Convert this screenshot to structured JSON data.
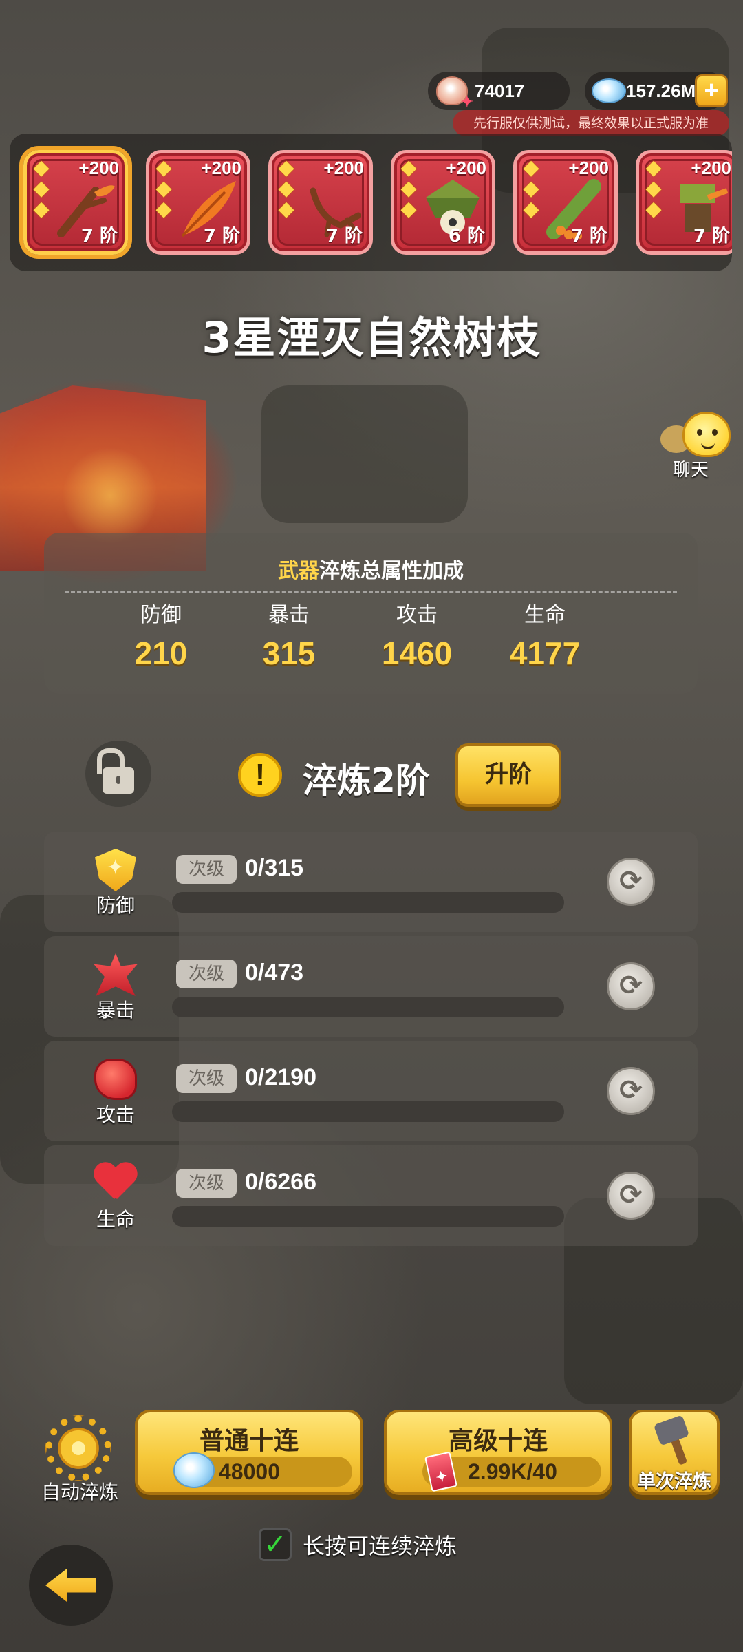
{
  "currency": {
    "shells": "74017",
    "gems": "157.26M",
    "shell_icon": "shell-icon",
    "gem_icon": "gem-icon",
    "notice": "先行服仅供测试，最终效果以正式服为准"
  },
  "weapons": [
    {
      "bonus": "+200",
      "rank": "7 阶",
      "stars": 3,
      "selected": true
    },
    {
      "bonus": "+200",
      "rank": "7 阶",
      "stars": 3
    },
    {
      "bonus": "+200",
      "rank": "7 阶",
      "stars": 3
    },
    {
      "bonus": "+200",
      "rank": "6 阶",
      "stars": 3
    },
    {
      "bonus": "+200",
      "rank": "7 阶",
      "stars": 3
    },
    {
      "bonus": "+200",
      "rank": "7 阶",
      "stars": 3
    }
  ],
  "title": "3星湮灭自然树枝",
  "chat": {
    "label": "聊天"
  },
  "stats": {
    "title_accent": "武器",
    "title_rest": "淬炼总属性加成",
    "items": [
      {
        "name": "防御",
        "value": "210"
      },
      {
        "name": "暴击",
        "value": "315"
      },
      {
        "name": "攻击",
        "value": "1460"
      },
      {
        "name": "生命",
        "value": "4177"
      }
    ]
  },
  "refine": {
    "level": "淬炼2阶",
    "upgrade_label": "升阶"
  },
  "attributes": [
    {
      "label": "防御",
      "grade": "次级",
      "progress": "0/315",
      "fill": 0,
      "icon": "shield-icon"
    },
    {
      "label": "暴击",
      "grade": "次级",
      "progress": "0/473",
      "fill": 0,
      "icon": "crit-icon"
    },
    {
      "label": "攻击",
      "grade": "次级",
      "progress": "0/2190",
      "fill": 0,
      "icon": "fist-icon"
    },
    {
      "label": "生命",
      "grade": "次级",
      "progress": "0/6266",
      "fill": 0,
      "icon": "heart-icon"
    }
  ],
  "actions": {
    "auto_label": "自动淬炼",
    "normal_ten": {
      "title": "普通十连",
      "cost": "48000"
    },
    "advanced_ten": {
      "title": "高级十连",
      "cost": "2.99K/40"
    },
    "single_label": "单次淬炼",
    "hold_label": "长按可连续淬炼",
    "hold_checked": true
  },
  "colors": {
    "accent_gold": "#ffd54a",
    "card_red": "#d4404a",
    "button_yellow": "#f6c93b"
  }
}
